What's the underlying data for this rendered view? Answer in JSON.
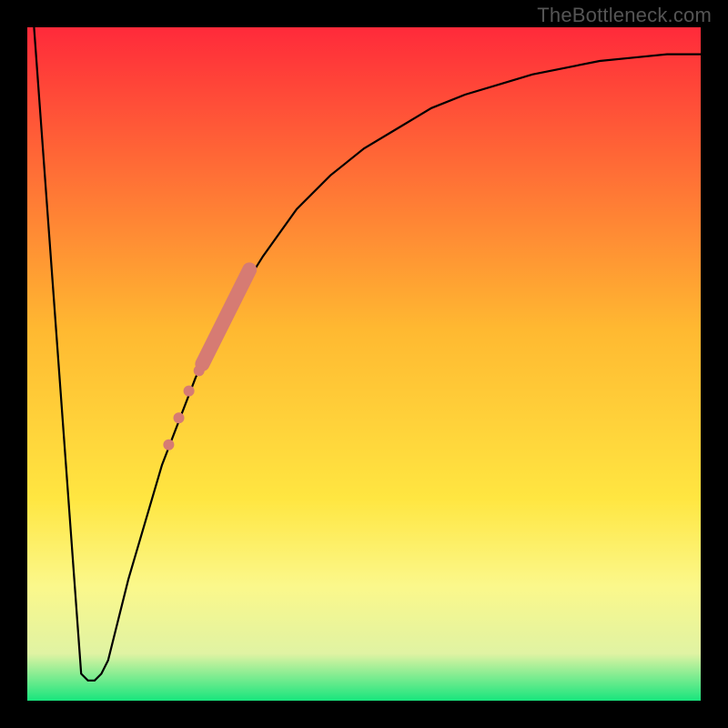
{
  "watermark": "TheBottleneck.com",
  "chart_data": {
    "type": "line",
    "title": "",
    "xlabel": "",
    "ylabel": "",
    "xlim": [
      0,
      100
    ],
    "ylim": [
      0,
      100
    ],
    "grid": false,
    "legend": false,
    "background_gradient": {
      "stops": [
        {
          "offset": 0.0,
          "color": "#ff2a3a"
        },
        {
          "offset": 0.45,
          "color": "#ffb931"
        },
        {
          "offset": 0.7,
          "color": "#ffe641"
        },
        {
          "offset": 0.83,
          "color": "#fbf88b"
        },
        {
          "offset": 0.93,
          "color": "#e0f3a3"
        },
        {
          "offset": 1.0,
          "color": "#18e57d"
        }
      ]
    },
    "series": [
      {
        "name": "curve",
        "color": "#000000",
        "x": [
          1,
          8,
          9,
          10,
          11,
          12,
          15,
          20,
          25,
          30,
          35,
          40,
          45,
          50,
          55,
          60,
          65,
          70,
          75,
          80,
          85,
          90,
          95,
          100
        ],
        "y": [
          100,
          4,
          3,
          3,
          4,
          6,
          18,
          35,
          48,
          58,
          66,
          73,
          78,
          82,
          85,
          88,
          90,
          91.5,
          93,
          94,
          95,
          95.5,
          96,
          96
        ]
      }
    ],
    "markers": {
      "color": "#d67b73",
      "points": [
        {
          "x": 21,
          "y": 38,
          "r": 6
        },
        {
          "x": 22.5,
          "y": 42,
          "r": 6
        },
        {
          "x": 24,
          "y": 46,
          "r": 6
        },
        {
          "x": 25.5,
          "y": 49,
          "r": 6
        }
      ],
      "thick_segment": {
        "x0": 26,
        "y0": 50,
        "x1": 33,
        "y1": 64,
        "width": 16
      }
    }
  }
}
